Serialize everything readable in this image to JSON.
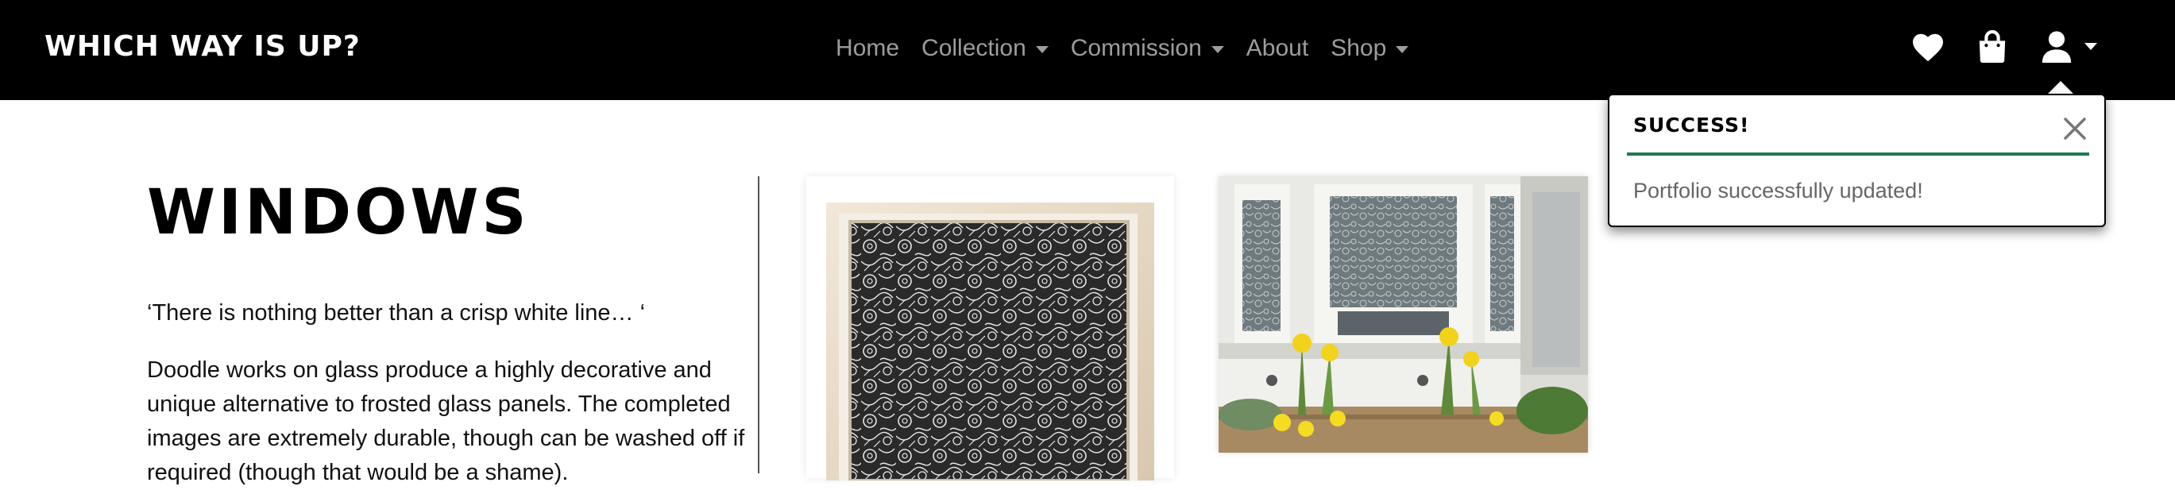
{
  "navbar": {
    "brand": "WHICH WAY IS UP?",
    "background": "#000000",
    "items": [
      {
        "label": "Home",
        "dropdown": false
      },
      {
        "label": "Collection",
        "dropdown": true
      },
      {
        "label": "Commission",
        "dropdown": true
      },
      {
        "label": "About",
        "dropdown": false
      },
      {
        "label": "Shop",
        "dropdown": true
      }
    ],
    "icons": [
      "heart-icon",
      "shopping-bag-icon",
      "user-icon"
    ]
  },
  "page": {
    "title": "WINDOWS",
    "quote": "‘There is nothing better than a crisp white line… ‘",
    "description": "Doodle works on glass produce a highly decorative and unique alternative to frosted glass panels. The completed images are extremely durable, though can be washed off if required (though that would be a shame)."
  },
  "gallery": {
    "images": [
      "framed-doodle-glass-panel",
      "bay-window-with-doodle-glass-and-daffodils"
    ]
  },
  "toast": {
    "title": "SUCCESS!",
    "message": "Portfolio successfully updated!",
    "accent": "#1d7a4f"
  }
}
